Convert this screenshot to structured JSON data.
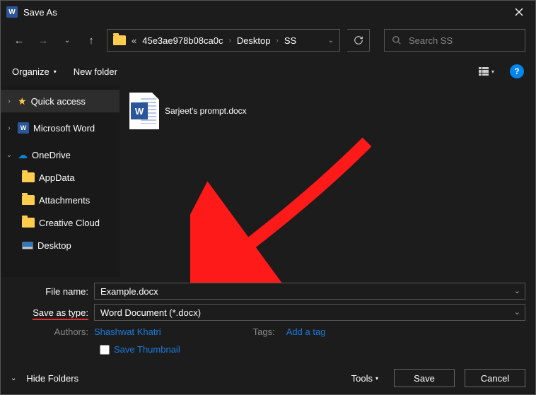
{
  "window": {
    "title": "Save As"
  },
  "breadcrumbs": {
    "seg1": "45e3ae978b08ca0c",
    "seg2": "Desktop",
    "seg3": "SS"
  },
  "search": {
    "placeholder": "Search SS"
  },
  "toolbar": {
    "organize": "Organize",
    "newfolder": "New folder"
  },
  "sidebar": {
    "quick_access": "Quick access",
    "ms_word": "Microsoft Word",
    "onedrive": "OneDrive",
    "appdata": "AppData",
    "attachments": "Attachments",
    "creative_cloud": "Creative Cloud",
    "desktop": "Desktop"
  },
  "files": {
    "item1": "Sarjeet's prompt.docx"
  },
  "form": {
    "filename_label": "File name:",
    "filename_value": "Example.docx",
    "saveas_label": "Save as type:",
    "saveas_value": "Word Document (*.docx)",
    "authors_label": "Authors:",
    "authors_value": "Shashwat Khatri",
    "tags_label": "Tags:",
    "tags_value": "Add a tag",
    "save_thumbnail": "Save Thumbnail"
  },
  "footer": {
    "hide_folders": "Hide Folders",
    "tools": "Tools",
    "save": "Save",
    "cancel": "Cancel"
  }
}
